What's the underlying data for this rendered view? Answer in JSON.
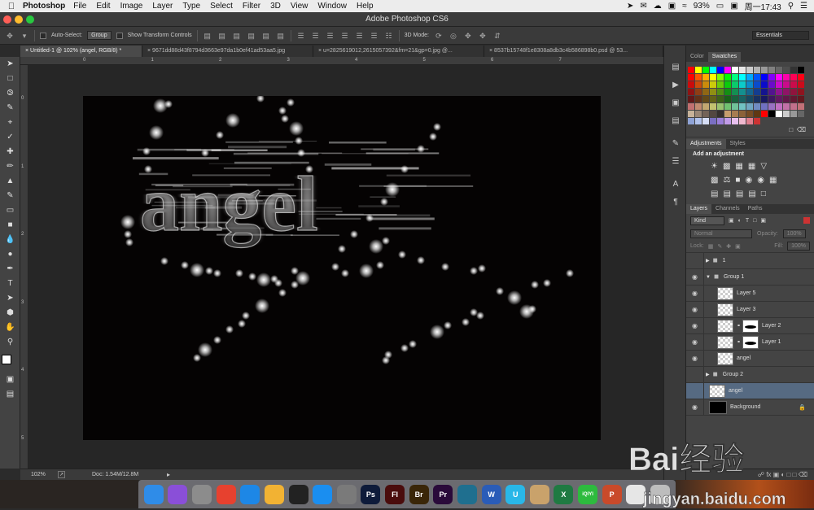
{
  "menubar": {
    "app": "Photoshop",
    "items": [
      "File",
      "Edit",
      "Image",
      "Layer",
      "Type",
      "Select",
      "Filter",
      "3D",
      "View",
      "Window",
      "Help"
    ],
    "battery": "93%",
    "clock": "周一17:43"
  },
  "window": {
    "title": "Adobe Photoshop CS6"
  },
  "options": {
    "auto_select_label": "Auto-Select:",
    "auto_select_value": "Group",
    "transform_label": "Show Transform Controls",
    "mode_3d_label": "3D Mode:",
    "workspace": "Essentials"
  },
  "tabs": [
    {
      "label": "Untitled-1 @ 102% (angel, RGB/8) *",
      "active": true
    },
    {
      "label": "9671dd88d43f8794d3663e97da1b0ef41ad53aa5.jpg",
      "active": false
    },
    {
      "label": "u=2825619012,2615057392&fm=21&gp=0.jpg @...",
      "active": false
    },
    {
      "label": "8537b15748f1e8308a8db3c4b586898b0.psd @ 53...",
      "active": false
    }
  ],
  "ruler_top": [
    "0",
    "1",
    "2",
    "3",
    "4",
    "5",
    "6",
    "7"
  ],
  "ruler_left": [
    "0",
    "1",
    "2",
    "3",
    "4",
    "5"
  ],
  "canvas": {
    "text": "angel"
  },
  "status": {
    "zoom": "102%",
    "doc": "Doc: 1.54M/12.8M"
  },
  "color_panel": {
    "tabs": [
      "Color",
      "Swatches"
    ],
    "active": "Swatches"
  },
  "adjustments": {
    "tabs": [
      "Adjustments",
      "Styles"
    ],
    "title": "Add an adjustment"
  },
  "layers_panel": {
    "tabs": [
      "Layers",
      "Channels",
      "Paths"
    ],
    "kind": "Kind",
    "blend": "Normal",
    "opacity_label": "Opacity:",
    "opacity": "100%",
    "lock_label": "Lock:",
    "fill_label": "Fill:",
    "fill": "100%",
    "layers": [
      {
        "name": "1",
        "type": "group",
        "visible": false,
        "indent": 0,
        "collapsed": true
      },
      {
        "name": "Group 1",
        "type": "group",
        "visible": true,
        "indent": 0,
        "collapsed": false
      },
      {
        "name": "Layer 5",
        "type": "layer",
        "visible": true,
        "indent": 1
      },
      {
        "name": "Layer 3",
        "type": "layer",
        "visible": true,
        "indent": 1
      },
      {
        "name": "Layer 2",
        "type": "masked",
        "visible": true,
        "indent": 1
      },
      {
        "name": "Layer 1",
        "type": "masked",
        "visible": true,
        "indent": 1
      },
      {
        "name": "angel",
        "type": "layer",
        "visible": true,
        "indent": 1
      },
      {
        "name": "Group 2",
        "type": "group",
        "visible": false,
        "indent": 0,
        "collapsed": true
      },
      {
        "name": "angel",
        "type": "layer",
        "visible": false,
        "indent": 0,
        "selected": true
      },
      {
        "name": "Background",
        "type": "background",
        "visible": true,
        "indent": 0
      }
    ]
  },
  "dock_icons": [
    {
      "name": "finder",
      "label": "",
      "color": "#2f8ce8"
    },
    {
      "name": "siri",
      "label": "",
      "color": "#8a4fd8"
    },
    {
      "name": "launchpad",
      "label": "",
      "color": "#8c8c8c"
    },
    {
      "name": "chrome",
      "label": "",
      "color": "#e7412f"
    },
    {
      "name": "safari",
      "label": "",
      "color": "#1d87e6"
    },
    {
      "name": "photos",
      "label": "",
      "color": "#f2b233"
    },
    {
      "name": "qq",
      "label": "",
      "color": "#222222"
    },
    {
      "name": "app-store",
      "label": "",
      "color": "#1a8ef0"
    },
    {
      "name": "system-preferences",
      "label": "",
      "color": "#7a7a7a"
    },
    {
      "name": "photoshop",
      "label": "Ps",
      "color": "#0e1b3a"
    },
    {
      "name": "flash",
      "label": "Fl",
      "color": "#4a0c0c"
    },
    {
      "name": "bridge",
      "label": "Br",
      "color": "#3a2608"
    },
    {
      "name": "premiere",
      "label": "Pr",
      "color": "#2a0a3a"
    },
    {
      "name": "browser",
      "label": "",
      "color": "#1f6f8f"
    },
    {
      "name": "word",
      "label": "W",
      "color": "#2a5cb8"
    },
    {
      "name": "u-app",
      "label": "U",
      "color": "#29b7e8"
    },
    {
      "name": "archive",
      "label": "",
      "color": "#c9a26b"
    },
    {
      "name": "excel",
      "label": "X",
      "color": "#1f7a42"
    },
    {
      "name": "iqiyi",
      "label": "iQIYI",
      "color": "#2dbb3e"
    },
    {
      "name": "powerpoint",
      "label": "P",
      "color": "#c94a2a"
    },
    {
      "name": "preview",
      "label": "",
      "color": "#e6e6e6"
    },
    {
      "name": "trash",
      "label": "",
      "color": "#bdbdbd"
    }
  ],
  "watermark": {
    "text": "Bai经验",
    "url": "jingyan.baidu.com"
  },
  "colors": {
    "canvas": "#050303",
    "panel": "#444444",
    "selected_layer": "#566a82"
  }
}
